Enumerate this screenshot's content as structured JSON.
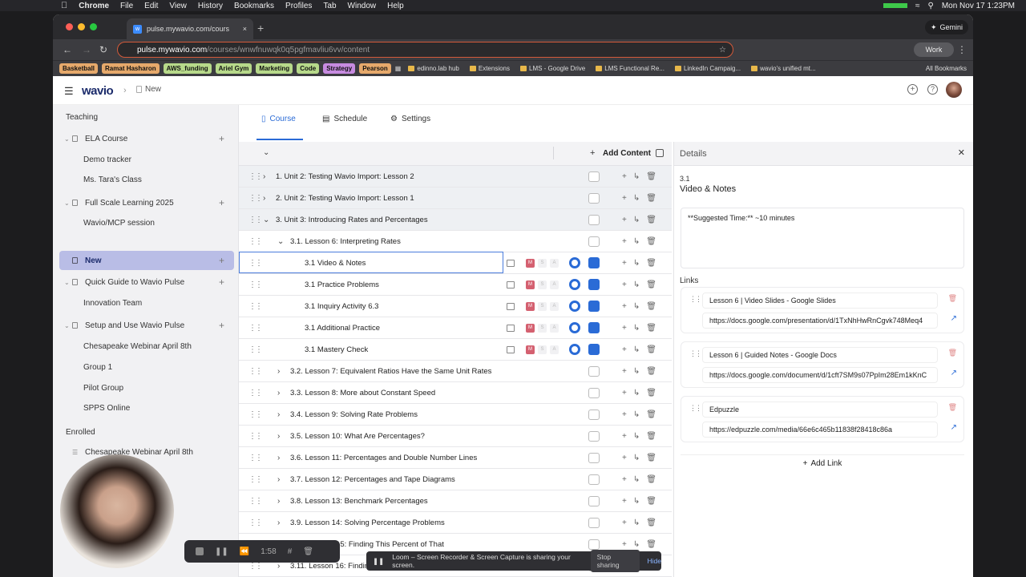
{
  "menubar": {
    "app": "Chrome",
    "items": [
      "File",
      "Edit",
      "View",
      "History",
      "Bookmarks",
      "Profiles",
      "Tab",
      "Window",
      "Help"
    ],
    "clock": "Mon Nov 17  1:23PM"
  },
  "browser": {
    "tab_title": "pulse.mywavio.com/cours",
    "url_host": "pulse.mywavio.com",
    "url_path": "/courses/wnwfnuwqk0q5pgfmavliu6vv/content",
    "gemini": "Gemini",
    "profile": "Work",
    "bookmarks_colored": [
      {
        "label": "Basketball",
        "color": "#e6a96b"
      },
      {
        "label": "Ramat Hasharon",
        "color": "#e6a96b"
      },
      {
        "label": "AWS_funding",
        "color": "#b7d98a"
      },
      {
        "label": "Ariel Gym",
        "color": "#b7d98a"
      },
      {
        "label": "Marketing",
        "color": "#b7d98a"
      },
      {
        "label": "Code",
        "color": "#b7d98a"
      },
      {
        "label": "Strategy",
        "color": "#c78be0"
      },
      {
        "label": "Pearson",
        "color": "#e6a96b"
      }
    ],
    "bookmarks_plain": [
      "edinno.lab hub",
      "Extensions",
      "LMS - Google Drive",
      "LMS Functional Re...",
      "LinkedIn Campaig...",
      "wavio's unified mt..."
    ],
    "all_bookmarks": "All Bookmarks"
  },
  "app": {
    "logo": "wavio",
    "breadcrumb": "New"
  },
  "sidebar": {
    "section_teaching": "Teaching",
    "items": [
      {
        "label": "ELA Course",
        "type": "group"
      },
      {
        "label": "Demo tracker",
        "type": "sub"
      },
      {
        "label": "Ms. Tara's Class",
        "type": "sub"
      },
      {
        "label": "Full Scale Learning 2025",
        "type": "group"
      },
      {
        "label": "Wavio/MCP session",
        "type": "sub"
      },
      {
        "label": "New",
        "type": "active"
      },
      {
        "label": "Quick Guide to Wavio Pulse",
        "type": "group"
      },
      {
        "label": "Innovation Team",
        "type": "sub"
      },
      {
        "label": "Setup and Use Wavio Pulse",
        "type": "group"
      },
      {
        "label": "Chesapeake Webinar April 8th",
        "type": "sub"
      },
      {
        "label": "Group 1",
        "type": "sub"
      },
      {
        "label": "Pilot Group",
        "type": "sub"
      },
      {
        "label": "SPPS Online",
        "type": "sub"
      }
    ],
    "section_enrolled": "Enrolled",
    "enrolled_item": "Chesapeake Webinar April 8th"
  },
  "tabs": {
    "course": "Course",
    "schedule": "Schedule",
    "settings": "Settings"
  },
  "content": {
    "add_content": "Add Content",
    "rows": [
      {
        "label": "1.  Unit 2: Testing Wavio Import: Lesson 2",
        "level": 0,
        "state": "collapsed"
      },
      {
        "label": "2.  Unit 2: Testing Wavio Import: Lesson 1",
        "level": 0,
        "state": "collapsed"
      },
      {
        "label": "3.  Unit 3: Introducing Rates and Percentages",
        "level": 0,
        "state": "expanded"
      },
      {
        "label": "3.1.  Lesson 6: Interpreting Rates",
        "level": 1,
        "state": "expanded"
      },
      {
        "label": "3.1  Video & Notes",
        "level": 2,
        "state": "leaf",
        "selected": true
      },
      {
        "label": "3.1  Practice Problems",
        "level": 2,
        "state": "leaf"
      },
      {
        "label": "3.1  Inquiry Activity 6.3",
        "level": 2,
        "state": "leaf"
      },
      {
        "label": "3.1  Additional Practice",
        "level": 2,
        "state": "leaf"
      },
      {
        "label": "3.1  Mastery Check",
        "level": 2,
        "state": "leaf"
      },
      {
        "label": "3.2.  Lesson 7: Equivalent Ratios Have the Same Unit Rates",
        "level": 1,
        "state": "collapsed"
      },
      {
        "label": "3.3.  Lesson 8: More about Constant Speed",
        "level": 1,
        "state": "collapsed"
      },
      {
        "label": "3.4.  Lesson 9: Solving Rate Problems",
        "level": 1,
        "state": "collapsed"
      },
      {
        "label": "3.5.  Lesson 10: What Are Percentages?",
        "level": 1,
        "state": "collapsed"
      },
      {
        "label": "3.6.  Lesson 11: Percentages and Double Number Lines",
        "level": 1,
        "state": "collapsed"
      },
      {
        "label": "3.7.  Lesson 12: Percentages and Tape Diagrams",
        "level": 1,
        "state": "collapsed"
      },
      {
        "label": "3.8.  Lesson 13: Benchmark Percentages",
        "level": 1,
        "state": "collapsed"
      },
      {
        "label": "3.9.  Lesson 14: Solving Percentage Problems",
        "level": 1,
        "state": "collapsed"
      },
      {
        "label": "3.10.  Lesson 15: Finding This Percent of That",
        "level": 1,
        "state": "collapsed"
      },
      {
        "label": "3.11.  Lesson 16: Finding",
        "level": 1,
        "state": "collapsed"
      }
    ],
    "badges": [
      "M",
      "S",
      "A"
    ]
  },
  "details": {
    "header": "Details",
    "number": "3.1",
    "title": "Video & Notes",
    "description": "**Suggested Time:** ~10 minutes",
    "links_label": "Links",
    "links": [
      {
        "title": "Lesson 6 | Video Slides - Google Slides",
        "url": "https://docs.google.com/presentation/d/1TxNhHwRnCgvk748Meq4"
      },
      {
        "title": "Lesson 6 | Guided Notes - Google Docs",
        "url": "https://docs.google.com/document/d/1cft7SM9s07PpIm28Em1kKnC"
      },
      {
        "title": "Edpuzzle",
        "url": "https://edpuzzle.com/media/66e6c465b11838f28418c86a"
      }
    ],
    "add_link": "Add Link"
  },
  "recorder": {
    "time": "1:58"
  },
  "loom": {
    "message": "Loom – Screen Recorder & Screen Capture is sharing your screen.",
    "stop": "Stop sharing",
    "hide": "Hide"
  }
}
